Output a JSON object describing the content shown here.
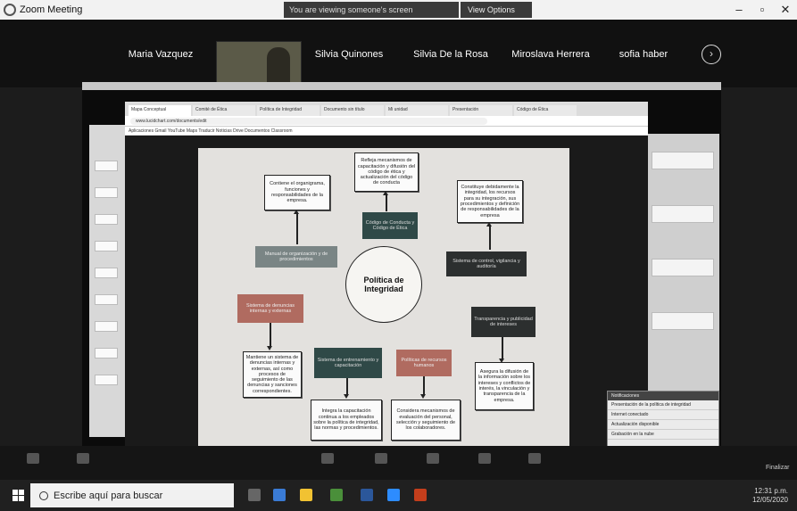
{
  "window": {
    "title": "Zoom Meeting",
    "share_banner": "You are viewing someone's screen",
    "share_options": "View Options",
    "controls": [
      "–",
      "▫",
      "✕"
    ]
  },
  "participants": [
    "Maria Vazquez",
    "Silvia  Quinones",
    "Silvia De la Rosa",
    "Miroslava Herrera",
    "sofia haber"
  ],
  "browser": {
    "tabs": [
      "Mapa Conceptual",
      "Comité de Ética",
      "Política de Integridad",
      "Documento sin título",
      "Mi unidad",
      "Presentación",
      "Código de Ética"
    ],
    "url": "www.lucidchart.com/documents/edit",
    "bookmarks": "Aplicaciones  Gmail  YouTube  Maps  Traducir  Noticias  Drive  Documentos  Classroom"
  },
  "map": {
    "center": "Política de Integridad",
    "nodes": {
      "top_center_desc": "Refleja mecanismos de capacitación y difusión del código de ética y actualización del código de conducta",
      "top_center_label": "Código de Conducta y Código de Ética",
      "top_left_desc": "Contiene el organigrama, funciones y responsabilidades de la empresa.",
      "top_left_label": "Manual de organización y de procedimientos",
      "top_right_desc": "Constituye debidamente la integridad, los recursos para su integración, sus procedimientos y definición de responsabilidades de la empresa",
      "top_right_label": "Sistema de control, vigilancia y auditoría",
      "left_label": "Sistema de denuncias internas y externas",
      "left_desc": "Mantiene un sistema de denuncias internas y externas, así como procesos de seguimiento de las denuncias y sanciones correspondientes.",
      "right_label": "Transparencia y publicidad de intereses",
      "right_desc": "Asegura la difusión de la información sobre los intereses y conflictos de interés, la vinculación y transparencia de la empresa.",
      "bottom_left_label": "Sistema de entrenamiento y capacitación",
      "bottom_left_desc": "Integra la capacitación continua a los empleados sobre la política de integridad, las normas y procedimientos.",
      "bottom_right_label": "Políticas de recursos humanos",
      "bottom_right_desc": "Considera mecanismos de evaluación del personal, selección y seguimiento de los colaboradores."
    }
  },
  "notification": {
    "header": "Notificaciones",
    "items": [
      "Presentación de la política de integridad",
      "Internet conectado",
      "Actualización disponible",
      "Grabación en la nube"
    ]
  },
  "toolbar": {
    "exit_label": "Finalizar"
  },
  "taskbar": {
    "search_placeholder": "Escribe aquí para buscar",
    "time": "12:31 p.m.",
    "date": "12/05/2020"
  },
  "colors": {
    "zoom_bg": "#1c1c1c",
    "map_bg": "#e3e1de",
    "teal": "#2f4947",
    "salmon": "#b06b60",
    "gray_node": "#7a8585"
  }
}
